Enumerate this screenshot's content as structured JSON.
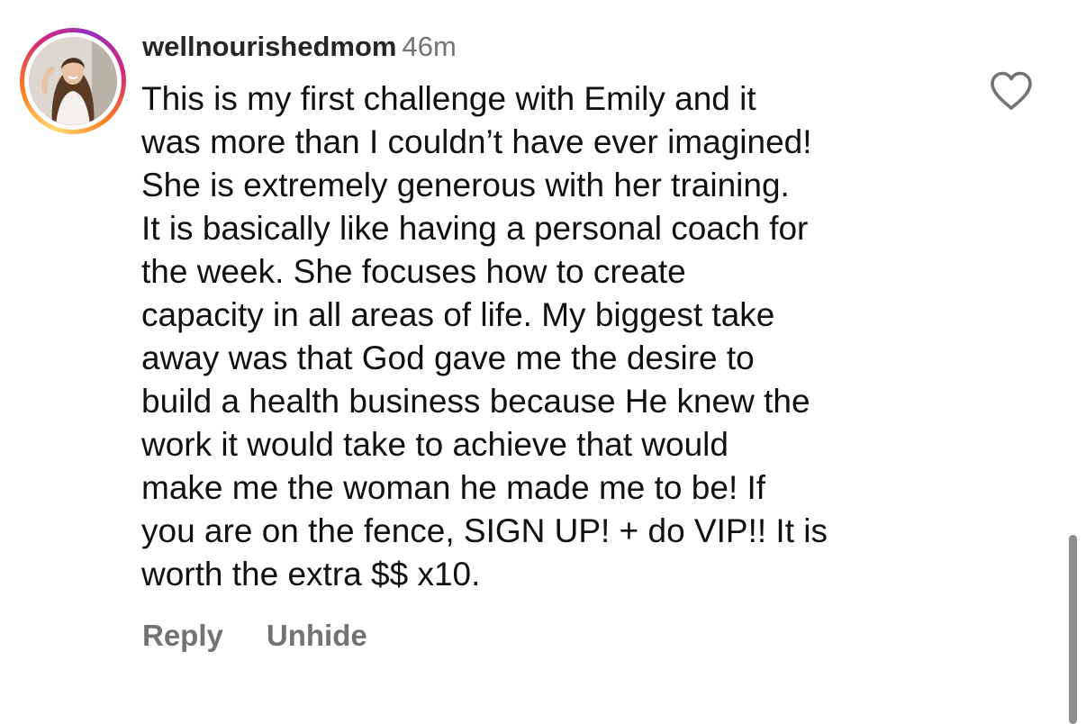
{
  "comment": {
    "username": "wellnourishedmom",
    "timestamp": "46m",
    "text": "This is my first challenge with Emily and it\nwas more than I couldn’t have ever imagined!\nShe is extremely generous with her training.\nIt is basically like having a personal coach for\nthe week. She focuses how to create\ncapacity in all areas of life. My biggest take\naway was that God gave me the desire to\nbuild a health business because He knew the\nwork it would take to achieve that would\nmake me the woman he made me to be! If\nyou are on the fence, SIGN UP! + do VIP!! It is\nworth the extra $$ x10.",
    "actions": {
      "reply_label": "Reply",
      "unhide_label": "Unhide"
    },
    "like_icon": "heart-outline-icon",
    "avatar_ring_colors": [
      "#feda75",
      "#fa7e1e",
      "#d62976",
      "#962fbf"
    ]
  },
  "colors": {
    "username": "#262626",
    "secondary_text": "#737373",
    "body_text": "#111111",
    "icon_stroke": "#737373",
    "scrollbar": "#8e8e8e"
  }
}
